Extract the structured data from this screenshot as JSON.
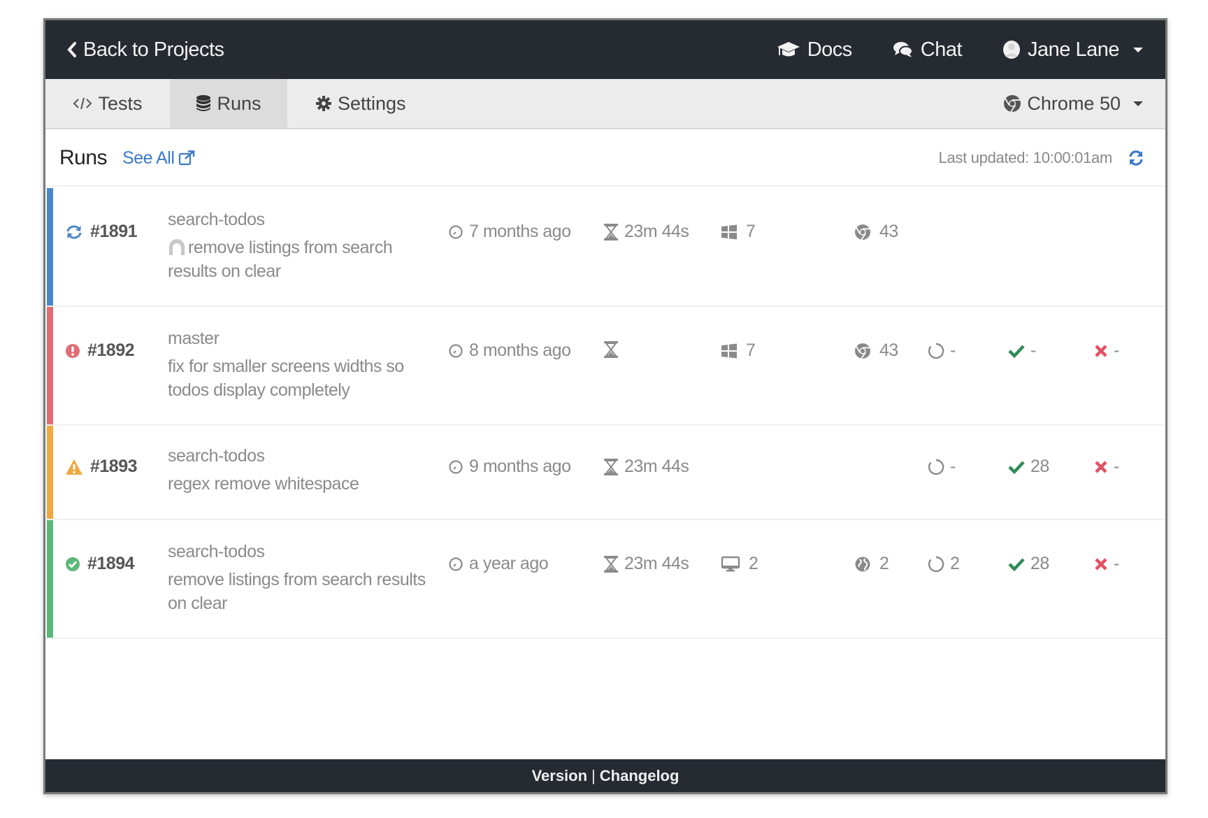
{
  "topbar": {
    "back_label": "Back to Projects",
    "docs_label": "Docs",
    "chat_label": "Chat",
    "user_name": "Jane Lane"
  },
  "tabs": [
    {
      "label": "Tests",
      "icon": "code-icon",
      "active": false
    },
    {
      "label": "Runs",
      "icon": "database-icon",
      "active": true
    },
    {
      "label": "Settings",
      "icon": "gear-icon",
      "active": false
    }
  ],
  "browser_selector": {
    "label": "Chrome 50",
    "icon": "chrome-icon"
  },
  "runs_header": {
    "title": "Runs",
    "see_all_label": "See All",
    "last_updated": "Last updated: 10:00:01am"
  },
  "colors": {
    "running": "#4a86c8",
    "failed": "#e06c75",
    "warning": "#f0a840",
    "passed": "#5cb87a",
    "link": "#3b79c8",
    "pass_check": "#2e8b57",
    "fail_x": "#e05262"
  },
  "runs": [
    {
      "id": "#1891",
      "status": "running",
      "branch": "search-todos",
      "message": "remove listings from search results on clear",
      "has_avatar": true,
      "time": "7 months ago",
      "duration": "23m 44s",
      "os_icon": "windows-icon",
      "os_count": "7",
      "browser_icon": "chrome-icon",
      "browser_count": "43",
      "pending": null,
      "passed": null,
      "failed": null
    },
    {
      "id": "#1892",
      "status": "failed",
      "branch": "master",
      "message": "fix for smaller screens widths so todos display completely",
      "has_avatar": false,
      "time": "8 months ago",
      "duration": "",
      "os_icon": "windows-icon",
      "os_count": "7",
      "browser_icon": "chrome-icon",
      "browser_count": "43",
      "pending": "-",
      "passed": "-",
      "failed": "-"
    },
    {
      "id": "#1893",
      "status": "warning",
      "branch": "search-todos",
      "message": "regex remove whitespace",
      "has_avatar": false,
      "time": "9 months ago",
      "duration": "23m 44s",
      "os_icon": null,
      "os_count": null,
      "browser_icon": null,
      "browser_count": null,
      "pending": "-",
      "passed": "28",
      "failed": "-"
    },
    {
      "id": "#1894",
      "status": "passed",
      "branch": "search-todos",
      "message": "remove listings from search results on clear",
      "has_avatar": false,
      "time": "a year ago",
      "duration": "23m 44s",
      "os_icon": "desktop-icon",
      "os_count": "2",
      "browser_icon": "globe-icon",
      "browser_count": "2",
      "pending": "2",
      "passed": "28",
      "failed": "-"
    }
  ],
  "footer": {
    "version_label": "Version",
    "separator": "|",
    "changelog_label": "Changelog"
  }
}
